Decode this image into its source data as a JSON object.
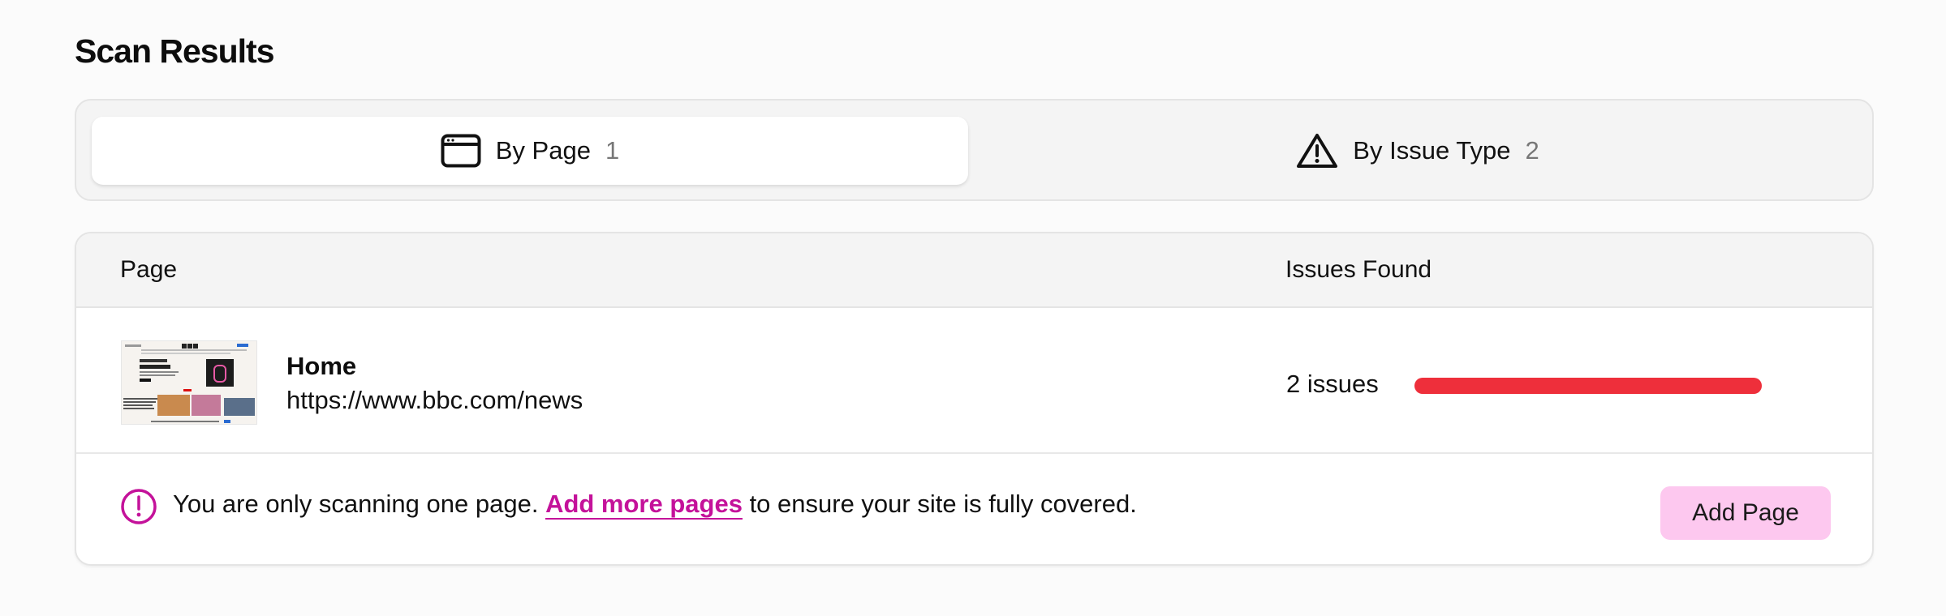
{
  "header": {
    "title": "Scan Results"
  },
  "tabs": [
    {
      "label": "By Page",
      "count": "1",
      "icon": "browser-window-icon",
      "active": true
    },
    {
      "label": "By Issue Type",
      "count": "2",
      "icon": "warning-triangle-icon",
      "active": false
    }
  ],
  "table": {
    "columns": {
      "page": "Page",
      "issues": "Issues Found"
    },
    "rows": [
      {
        "name": "Home",
        "url": "https://www.bbc.com/news",
        "issues_label": "2 issues",
        "issues_fraction": 1.0,
        "thumbnail_icon": "page-thumbnail"
      }
    ]
  },
  "notice": {
    "icon": "alert-circle-icon",
    "text_before": "You are only scanning one page. ",
    "link_label": "Add more pages",
    "text_after": " to ensure your site is fully covered.",
    "button_label": "Add Page"
  },
  "colors": {
    "accent": "#c4129a",
    "button_bg": "#fdc8ef",
    "issue_bar": "#ee2f3b"
  }
}
